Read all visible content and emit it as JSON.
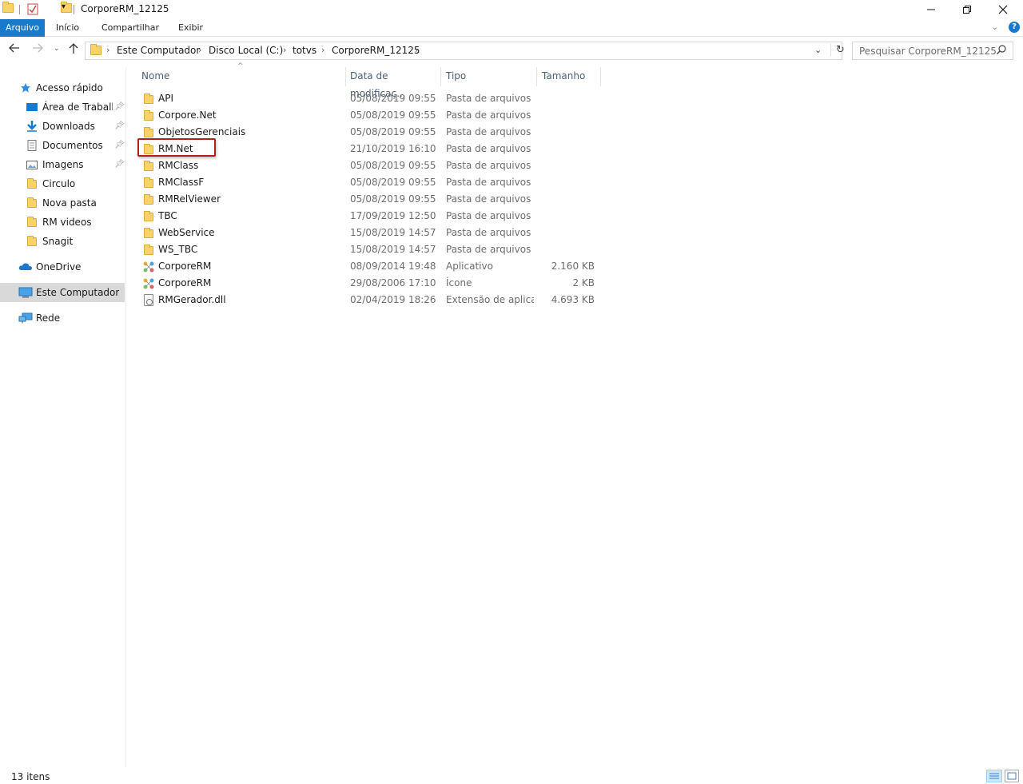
{
  "window": {
    "title": "CorporeRM_12125"
  },
  "ribbon": {
    "tabs": [
      "Arquivo",
      "Início",
      "Compartilhar",
      "Exibir"
    ]
  },
  "address": {
    "crumbs": [
      "Este Computador",
      "Disco Local (C:)",
      "totvs",
      "CorporeRM_12125"
    ]
  },
  "search": {
    "placeholder": "Pesquisar CorporeRM_12125"
  },
  "sidebar": {
    "items": [
      {
        "label": "Acesso rápido",
        "icon": "star-icon"
      },
      {
        "label": "Área de Trabalho",
        "icon": "desktop-icon",
        "pinned": true
      },
      {
        "label": "Downloads",
        "icon": "download-arrow-icon",
        "pinned": true
      },
      {
        "label": "Documentos",
        "icon": "document-icon",
        "pinned": true
      },
      {
        "label": "Imagens",
        "icon": "pictures-icon",
        "pinned": true
      },
      {
        "label": "Circulo",
        "icon": "folder-icon"
      },
      {
        "label": "Nova pasta",
        "icon": "folder-icon"
      },
      {
        "label": "RM videos",
        "icon": "folder-icon"
      },
      {
        "label": "Snagit",
        "icon": "folder-icon"
      },
      {
        "label": "OneDrive",
        "icon": "cloud-icon"
      },
      {
        "label": "Este Computador",
        "icon": "computer-icon",
        "selected": true
      },
      {
        "label": "Rede",
        "icon": "network-icon"
      }
    ]
  },
  "columns": {
    "name": "Nome",
    "date": "Data de modificaç...",
    "type": "Tipo",
    "size": "Tamanho"
  },
  "files": [
    {
      "name": "API",
      "date": "05/08/2019 09:55",
      "type": "Pasta de arquivos",
      "size": "",
      "icon": "folder-icon"
    },
    {
      "name": "Corpore.Net",
      "date": "05/08/2019 09:55",
      "type": "Pasta de arquivos",
      "size": "",
      "icon": "folder-icon"
    },
    {
      "name": "ObjetosGerenciais",
      "date": "05/08/2019 09:55",
      "type": "Pasta de arquivos",
      "size": "",
      "icon": "folder-icon"
    },
    {
      "name": "RM.Net",
      "date": "21/10/2019 16:10",
      "type": "Pasta de arquivos",
      "size": "",
      "icon": "folder-icon",
      "highlighted": true
    },
    {
      "name": "RMClass",
      "date": "05/08/2019 09:55",
      "type": "Pasta de arquivos",
      "size": "",
      "icon": "folder-icon"
    },
    {
      "name": "RMClassF",
      "date": "05/08/2019 09:55",
      "type": "Pasta de arquivos",
      "size": "",
      "icon": "folder-icon"
    },
    {
      "name": "RMRelViewer",
      "date": "05/08/2019 09:55",
      "type": "Pasta de arquivos",
      "size": "",
      "icon": "folder-icon"
    },
    {
      "name": "TBC",
      "date": "17/09/2019 12:50",
      "type": "Pasta de arquivos",
      "size": "",
      "icon": "folder-icon"
    },
    {
      "name": "WebService",
      "date": "15/08/2019 14:57",
      "type": "Pasta de arquivos",
      "size": "",
      "icon": "folder-icon"
    },
    {
      "name": "WS_TBC",
      "date": "15/08/2019 14:57",
      "type": "Pasta de arquivos",
      "size": "",
      "icon": "folder-icon"
    },
    {
      "name": "CorporeRM",
      "date": "08/09/2014 19:48",
      "type": "Aplicativo",
      "size": "2.160 KB",
      "icon": "application-icon"
    },
    {
      "name": "CorporeRM",
      "date": "29/08/2006 17:10",
      "type": "Ícone",
      "size": "2 KB",
      "icon": "application-icon"
    },
    {
      "name": "RMGerador.dll",
      "date": "02/04/2019 18:26",
      "type": "Extensão de aplica...",
      "size": "4.693 KB",
      "icon": "dll-file-icon"
    }
  ],
  "status": {
    "count": "13 itens"
  },
  "colors": {
    "accent": "#1979ca",
    "highlight_border": "#b01e1e",
    "folder": "#f8d468"
  }
}
